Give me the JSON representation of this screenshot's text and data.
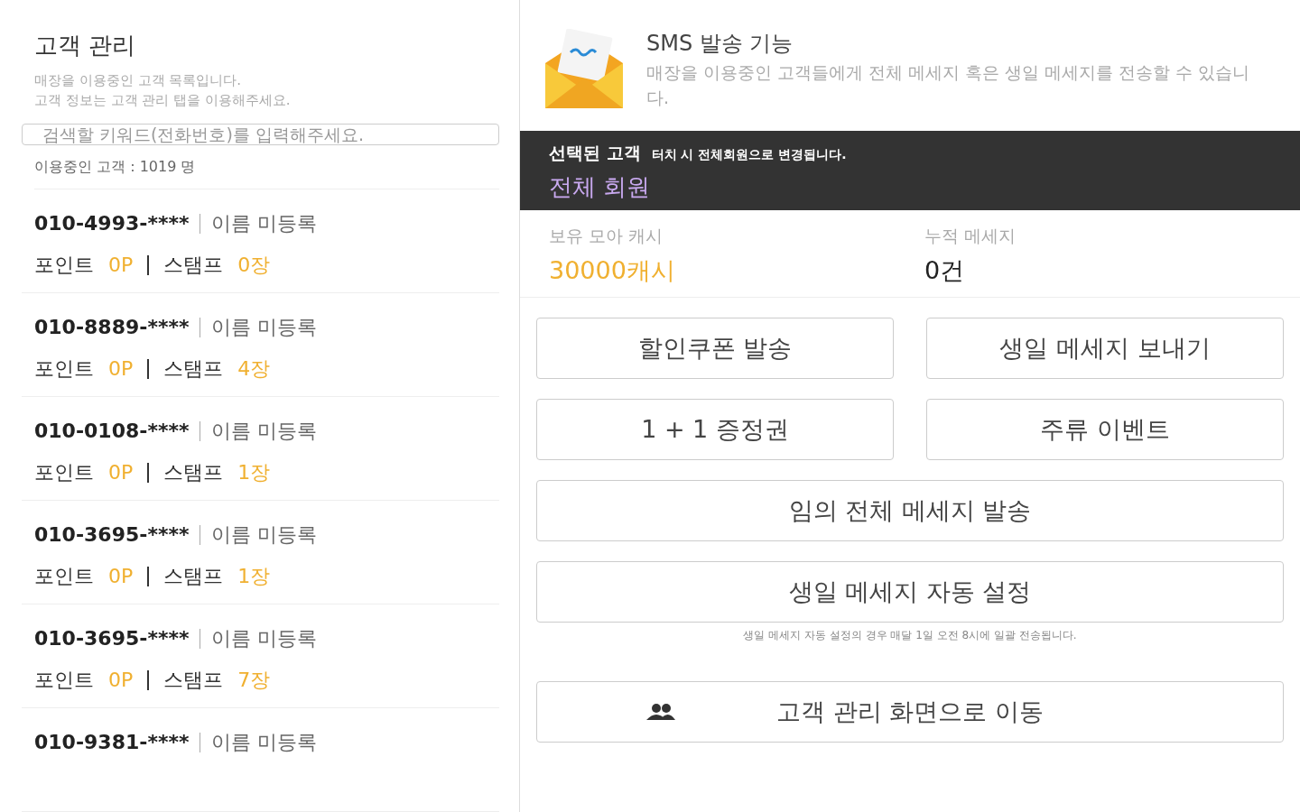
{
  "customer_panel": {
    "title": "고객 관리",
    "description": [
      "매장을 이용중인 고객 목록입니다.",
      "고객 정보는 고객 관리 탭을 이용해주세요."
    ],
    "search": {
      "placeholder": "검색할 키워드(전화번호)를 입력해주세요."
    },
    "count": "이용중인 고객 : 1019 명",
    "customers": [
      {
        "phone": "010-4993-****",
        "name": "이름 미등록",
        "point_label": "포인트",
        "points": "0P",
        "stamp_label": "스탬프",
        "stamps": "0장"
      },
      {
        "phone": "010-8889-****",
        "name": "이름 미등록",
        "point_label": "포인트",
        "points": "0P",
        "stamp_label": "스탬프",
        "stamps": "4장"
      },
      {
        "phone": "010-0108-****",
        "name": "이름 미등록",
        "point_label": "포인트",
        "points": "0P",
        "stamp_label": "스탬프",
        "stamps": "1장"
      },
      {
        "phone": "010-3695-****",
        "name": "이름 미등록",
        "point_label": "포인트",
        "points": "0P",
        "stamp_label": "스탬프",
        "stamps": "1장"
      },
      {
        "phone": "010-3695-****",
        "name": "이름 미등록",
        "point_label": "포인트",
        "points": "0P",
        "stamp_label": "스탬프",
        "stamps": "7장"
      },
      {
        "phone": "010-9381-****",
        "name": "이름 미등록"
      }
    ]
  },
  "sms_panel": {
    "title": "SMS 발송 기능",
    "description": "매장을 이용중인 고객들에게 전체 메세지 혹은 생일 메세지를 전송할 수 있습니다.",
    "selected_bar": {
      "label": "선택된 고객",
      "hint": "터치 시 전체회원으로 변경됩니다.",
      "value": "전체 회원"
    },
    "stats": [
      {
        "label": "보유 모아 캐시",
        "value": "30000캐시",
        "kind": "highlight"
      },
      {
        "label": "누적 메세지",
        "value": "0건",
        "kind": "plain"
      }
    ],
    "buttons": [
      {
        "label": "할인쿠폰 발송",
        "kind": "half"
      },
      {
        "label": "생일 메세지 보내기",
        "kind": "half"
      },
      {
        "label": "1 + 1 증정권",
        "kind": "half"
      },
      {
        "label": "주류 이벤트",
        "kind": "half"
      },
      {
        "label": "임의 전체 메세지 발송",
        "kind": "wide"
      },
      {
        "label": "생일 메세지 자동 설정",
        "kind": "wide"
      }
    ],
    "note": "생일 메세지 자동 설정의 경우 매달 1일 오전 8시에 일괄 전송됩니다.",
    "nav_button": {
      "label": "고객 관리 화면으로 이동"
    }
  }
}
